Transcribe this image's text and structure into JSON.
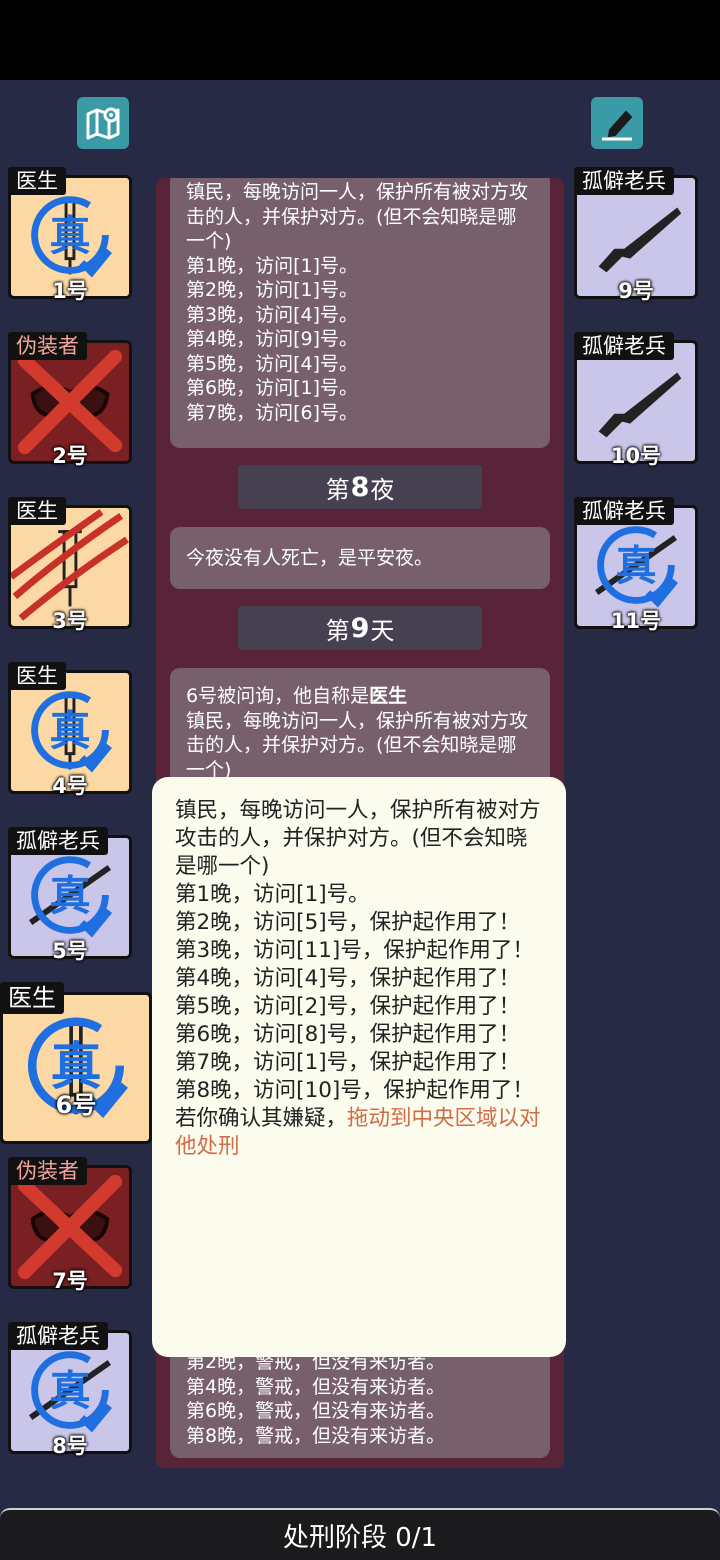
{
  "toolbar": {
    "left_icon": "map-pin-icon",
    "right_icon": "edit-note-icon"
  },
  "left_cards": [
    {
      "role": "医生",
      "number": "1号",
      "state": "真"
    },
    {
      "role": "伪装者",
      "number": "2号",
      "state": "dead"
    },
    {
      "role": "医生",
      "number": "3号",
      "state": "attacked"
    },
    {
      "role": "医生",
      "number": "4号",
      "state": "真"
    },
    {
      "role": "孤僻老兵",
      "number": "5号",
      "state": "真"
    },
    {
      "role": "医生",
      "number": "6号",
      "state": "真"
    },
    {
      "role": "伪装者",
      "number": "7号",
      "state": "dead"
    },
    {
      "role": "孤僻老兵",
      "number": "8号",
      "state": "真"
    }
  ],
  "right_cards": [
    {
      "role": "孤僻老兵",
      "number": "9号"
    },
    {
      "role": "孤僻老兵",
      "number": "10号"
    },
    {
      "role": "孤僻老兵",
      "number": "11号",
      "state": "真"
    }
  ],
  "log": {
    "entry1": {
      "desc": "镇民，每晚访问一人，保护所有被对方攻击的人，并保护对方。(但不会知晓是哪一个)",
      "lines": [
        "第1晚，访问[1]号。",
        "第2晚，访问[1]号。",
        "第3晚，访问[4]号。",
        "第4晚，访问[9]号。",
        "第5晚，访问[4]号。",
        "第6晚，访问[1]号。",
        "第7晚，访问[6]号。"
      ]
    },
    "night8": {
      "prefix": "第",
      "num": "8",
      "suffix": "夜"
    },
    "night8_text": "今夜没有人死亡，是平安夜。",
    "day9": {
      "prefix": "第",
      "num": "9",
      "suffix": "天"
    },
    "entry2": {
      "intro": "6号被问询，他自称是",
      "role": "医生",
      "desc": "镇民，每晚访问一人，保护所有被对方攻击的人，并保护对方。(但不会知晓是哪一个)"
    },
    "entry3": {
      "lines": [
        "第2晚，警戒，但没有来访者。",
        "第4晚，警戒，但没有来访者。",
        "第6晚，警戒，但没有来访者。",
        "第8晚，警戒，但没有来访者。"
      ]
    }
  },
  "popup": {
    "desc": "镇民，每晚访问一人，保护所有被对方攻击的人，并保护对方。(但不会知晓是哪一个)",
    "lines": [
      "第1晚，访问[1]号。",
      "第2晚，访问[5]号，保护起作用了！",
      "第3晚，访问[11]号，保护起作用了！",
      "第4晚，访问[4]号，保护起作用了！",
      "第5晚，访问[2]号，保护起作用了！",
      "第6晚，访问[8]号，保护起作用了！",
      "第7晚，访问[1]号，保护起作用了！",
      "第8晚，访问[10]号，保护起作用了！"
    ],
    "hint_prefix": "若你确认其嫌疑，",
    "hint_action": "拖动到中央区域以对他处刑"
  },
  "bottom_bar": {
    "label": "处刑阶段 0/1"
  },
  "colors": {
    "doctor_bg": "#fcd9a4",
    "veteran_bg": "#c9c6ea",
    "disguiser_bg": "#7a1f22",
    "verified_blue": "#1f6fe0",
    "hint": "#d06d46"
  }
}
